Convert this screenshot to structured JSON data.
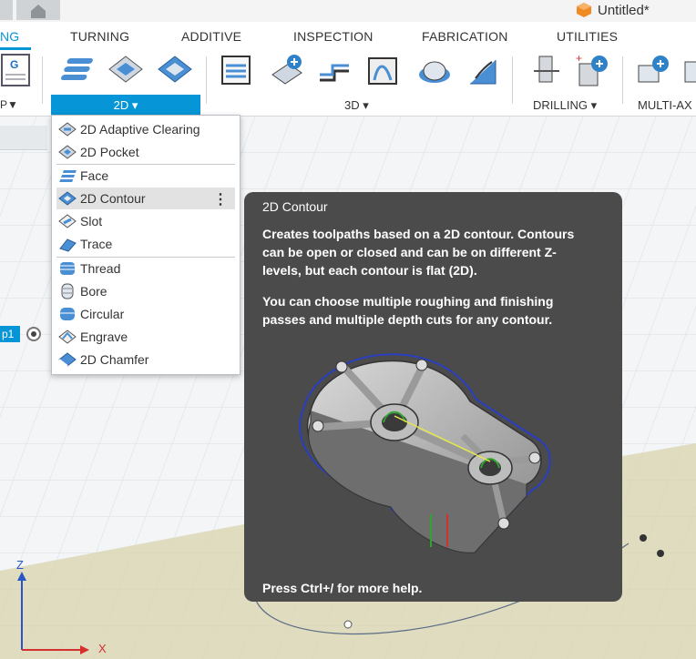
{
  "window": {
    "doc_title": "Untitled*"
  },
  "ribbon": {
    "tabs": [
      {
        "label": "NG",
        "active": true
      },
      {
        "label": "TURNING"
      },
      {
        "label": "ADDITIVE"
      },
      {
        "label": "INSPECTION"
      },
      {
        "label": "FABRICATION"
      },
      {
        "label": "UTILITIES"
      }
    ],
    "groups": {
      "left_partial": "P▼",
      "two_d": "2D",
      "three_d": "3D",
      "drilling": "DRILLING",
      "multi_axis": "MULTI-AX"
    },
    "accent": "#0696d7"
  },
  "menu": {
    "items": [
      {
        "label": "2D Adaptive Clearing",
        "icon": "adaptive-clearing-icon"
      },
      {
        "label": "2D Pocket",
        "icon": "pocket-icon"
      },
      {
        "label": "Face",
        "icon": "face-icon"
      },
      {
        "label": "2D Contour",
        "icon": "contour-icon",
        "highlighted": true
      },
      {
        "label": "Slot",
        "icon": "slot-icon"
      },
      {
        "label": "Trace",
        "icon": "trace-icon"
      },
      {
        "label": "Thread",
        "icon": "thread-icon"
      },
      {
        "label": "Bore",
        "icon": "bore-icon"
      },
      {
        "label": "Circular",
        "icon": "circular-icon"
      },
      {
        "label": "Engrave",
        "icon": "engrave-icon"
      },
      {
        "label": "2D Chamfer",
        "icon": "chamfer-icon"
      }
    ],
    "more_glyph": "⋮"
  },
  "tooltip": {
    "title": "2D Contour",
    "para1": "Creates toolpaths based on a 2D contour. Contours can be open or closed and can be on different Z-levels, but each contour is flat (2D).",
    "para2": "You can choose multiple roughing and finishing passes and multiple depth cuts for any contour.",
    "help": "Press Ctrl+/ for more help."
  },
  "viewport": {
    "left_chip": "p1",
    "axes": {
      "z": "Z",
      "x": "X"
    }
  }
}
